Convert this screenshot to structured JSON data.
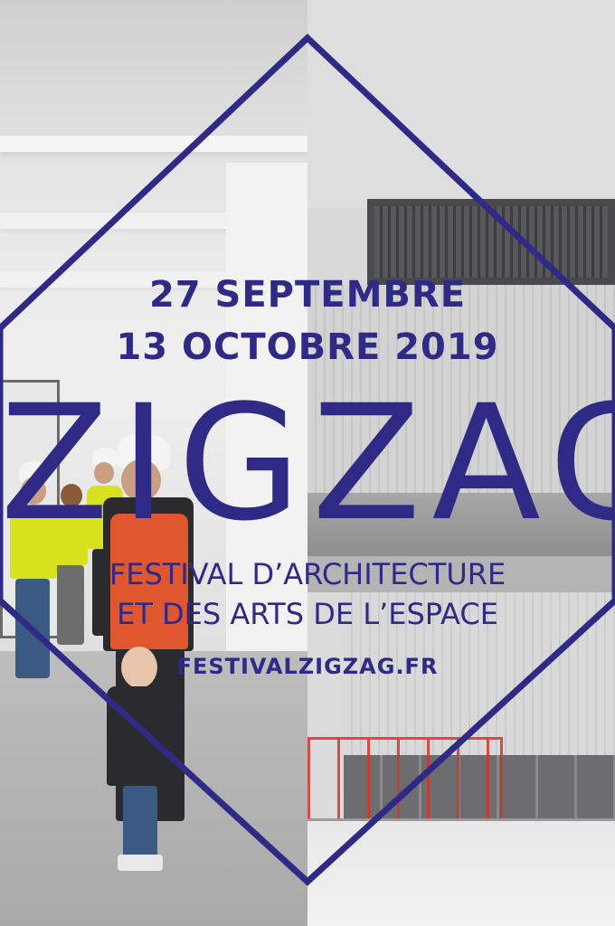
{
  "poster": {
    "date_line_1": "27 SEPTEMBRE",
    "date_line_2": "13 OCTOBRE 2019",
    "title": "ZIGZAG",
    "subtitle_line_1": "FESTIVAL D’ARCHITECTURE",
    "subtitle_line_2": "ET DES ARTS DE L’ESPACE",
    "website": "FESTIVALZIGZAG.FR"
  },
  "colors": {
    "brand_blue": "#2e2a86",
    "left_photo_tone": "#e0e0e0",
    "right_photo_tone": "#d8d8d8",
    "safety_vest_yellow": "#d6e21d",
    "safety_vest_orange": "#e0562e",
    "scaffold_red": "#d1362b"
  },
  "images": {
    "left": "construction-interior-photo",
    "right": "building-facade-photo"
  },
  "icons": [
    "diamond-frame"
  ]
}
